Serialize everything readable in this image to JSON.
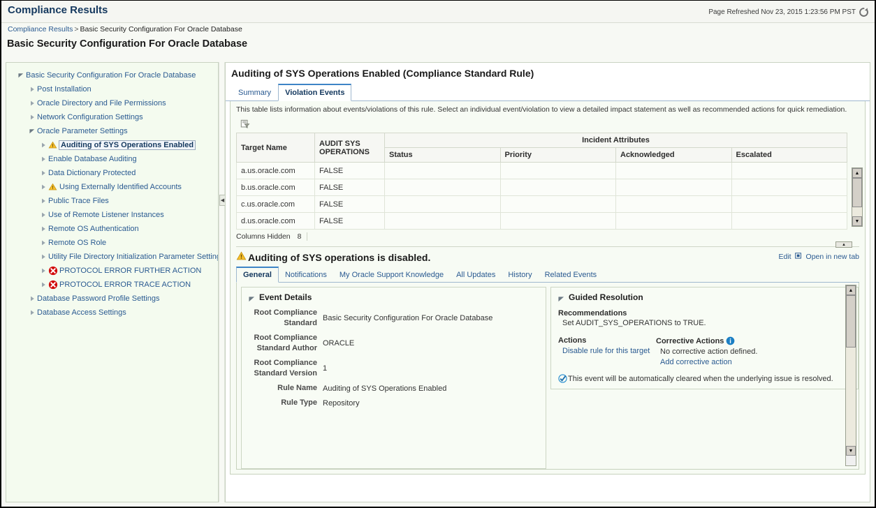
{
  "header": {
    "app_title": "Compliance Results",
    "refresh_text": "Page Refreshed Nov 23, 2015 1:23:56 PM PST",
    "refresh_icon": "refresh-icon"
  },
  "breadcrumb": {
    "root": "Compliance Results",
    "separator": ">",
    "current": "Basic Security Configuration For Oracle Database"
  },
  "page_heading": "Basic Security Configuration For Oracle Database",
  "sidebar": {
    "items": [
      {
        "label": "Basic Security Configuration For Oracle Database",
        "indent": 0,
        "state": "expanded",
        "icon": "none"
      },
      {
        "label": "Post Installation",
        "indent": 1,
        "state": "collapsed",
        "icon": "none"
      },
      {
        "label": "Oracle Directory and File Permissions",
        "indent": 1,
        "state": "collapsed",
        "icon": "none"
      },
      {
        "label": "Network Configuration Settings",
        "indent": 1,
        "state": "collapsed",
        "icon": "none"
      },
      {
        "label": "Oracle Parameter Settings",
        "indent": 1,
        "state": "expanded",
        "icon": "none"
      },
      {
        "label": "Auditing of SYS Operations Enabled",
        "indent": 2,
        "state": "collapsed",
        "icon": "warning",
        "selected": true
      },
      {
        "label": "Enable Database Auditing",
        "indent": 2,
        "state": "collapsed",
        "icon": "none"
      },
      {
        "label": "Data Dictionary Protected",
        "indent": 2,
        "state": "collapsed",
        "icon": "none"
      },
      {
        "label": "Using Externally Identified Accounts",
        "indent": 2,
        "state": "collapsed",
        "icon": "warning"
      },
      {
        "label": "Public Trace Files",
        "indent": 2,
        "state": "collapsed",
        "icon": "none"
      },
      {
        "label": "Use of Remote Listener Instances",
        "indent": 2,
        "state": "collapsed",
        "icon": "none"
      },
      {
        "label": "Remote OS Authentication",
        "indent": 2,
        "state": "collapsed",
        "icon": "none"
      },
      {
        "label": "Remote OS Role",
        "indent": 2,
        "state": "collapsed",
        "icon": "none"
      },
      {
        "label": "Utility File Directory Initialization Parameter Setting",
        "indent": 2,
        "state": "collapsed",
        "icon": "none"
      },
      {
        "label": "PROTOCOL ERROR FURTHER ACTION",
        "indent": 2,
        "state": "collapsed",
        "icon": "error"
      },
      {
        "label": "PROTOCOL ERROR TRACE ACTION",
        "indent": 2,
        "state": "collapsed",
        "icon": "error"
      },
      {
        "label": "Database Password Profile Settings",
        "indent": 1,
        "state": "collapsed",
        "icon": "none"
      },
      {
        "label": "Database Access Settings",
        "indent": 1,
        "state": "collapsed",
        "icon": "none"
      }
    ]
  },
  "main": {
    "title": "Auditing of SYS Operations Enabled (Compliance Standard Rule)",
    "tabs": [
      {
        "label": "Summary",
        "active": false
      },
      {
        "label": "Violation Events",
        "active": true
      }
    ],
    "note": "This table lists information about events/violations of this rule. Select an individual event/violation to view a detailed impact statement as well as recommended actions for quick remediation.",
    "toolbar": {
      "qbe_icon": "query-by-example-icon"
    },
    "table": {
      "group_header": "Incident Attributes",
      "columns": [
        "Target Name",
        "AUDIT SYS OPERATIONS",
        "Status",
        "Priority",
        "Acknowledged",
        "Escalated"
      ],
      "rows": [
        {
          "target_name": "a.us.oracle.com",
          "audit_sys_operations": "FALSE",
          "status": "",
          "priority": "",
          "acknowledged": "",
          "escalated": ""
        },
        {
          "target_name": "b.us.oracle.com",
          "audit_sys_operations": "FALSE",
          "status": "",
          "priority": "",
          "acknowledged": "",
          "escalated": ""
        },
        {
          "target_name": "c.us.oracle.com",
          "audit_sys_operations": "FALSE",
          "status": "",
          "priority": "",
          "acknowledged": "",
          "escalated": ""
        },
        {
          "target_name": "d.us.oracle.com",
          "audit_sys_operations": "FALSE",
          "status": "",
          "priority": "",
          "acknowledged": "",
          "escalated": ""
        }
      ],
      "columns_hidden_label": "Columns Hidden",
      "columns_hidden_count": "8"
    }
  },
  "detail": {
    "title": "Auditing of SYS operations is disabled.",
    "title_icon": "warning-icon",
    "edit_link": "Edit",
    "edit_icon": "external-link-icon",
    "open_new_tab_link": "Open in new tab",
    "tabs": [
      {
        "label": "General",
        "active": true
      },
      {
        "label": "Notifications",
        "active": false
      },
      {
        "label": "My Oracle Support Knowledge",
        "active": false
      },
      {
        "label": "All Updates",
        "active": false
      },
      {
        "label": "History",
        "active": false
      },
      {
        "label": "Related Events",
        "active": false
      }
    ],
    "event_details": {
      "title": "Event Details",
      "fields": [
        {
          "key": "Root Compliance Standard",
          "value": "Basic Security Configuration For Oracle Database"
        },
        {
          "key": "Root Compliance Standard Author",
          "value": "ORACLE"
        },
        {
          "key": "Root Compliance Standard Version",
          "value": "1"
        },
        {
          "key": "Rule Name",
          "value": "Auditing of SYS Operations Enabled"
        },
        {
          "key": "Rule Type",
          "value": "Repository"
        }
      ]
    },
    "guided_resolution": {
      "title": "Guided Resolution",
      "recommendations_label": "Recommendations",
      "recommendations_text": "Set AUDIT_SYS_OPERATIONS to TRUE.",
      "actions_label": "Actions",
      "actions_link": "Disable rule for this target",
      "corrective_actions_label": "Corrective Actions",
      "corrective_actions_info_icon": "info-icon",
      "corrective_actions_text": "No corrective action defined.",
      "corrective_actions_link": "Add corrective action",
      "auto_clear_icon": "check-icon",
      "auto_clear_text": "This event will be automatically cleared when the underlying issue is resolved."
    }
  },
  "colors": {
    "link": "#2a5a91",
    "accent": "#3d84c6",
    "warning": "#f0ad1e",
    "error": "#d40000",
    "panel_bg": "#f7fbf4"
  }
}
